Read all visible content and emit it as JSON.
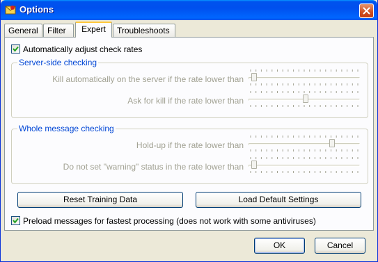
{
  "window": {
    "title": "Options"
  },
  "tabs": [
    {
      "label": "General"
    },
    {
      "label": "Filter"
    },
    {
      "label": "Expert",
      "active": true
    },
    {
      "label": "Troubleshoots"
    }
  ],
  "auto_adjust": {
    "label": "Automatically adjust check rates",
    "checked": true
  },
  "server_side": {
    "title": "Server-side checking",
    "kill_auto": {
      "label": "Kill automatically on the server if the rate lower than",
      "value": 0.03
    },
    "ask_kill": {
      "label": "Ask for kill if the rate lower than",
      "value": 0.51
    }
  },
  "whole_message": {
    "title": "Whole message checking",
    "hold_up": {
      "label": "Hold-up if the rate lower than",
      "value": 0.76
    },
    "no_warning": {
      "label": "Do not set \"warning\" status in the rate lower than",
      "value": 0.03
    }
  },
  "buttons": {
    "reset": "Reset Training Data",
    "load_default": "Load Default Settings",
    "ok": "OK",
    "cancel": "Cancel"
  },
  "preload": {
    "label": "Preload messages for fastest processing (does not work with some antiviruses)",
    "checked": true
  },
  "colors": {
    "titlebar": "#0054e3",
    "group_title": "#0046d5",
    "disabled_text": "#a1a192",
    "tab_highlight": "#ffc83c"
  },
  "icons": {
    "app": "app-icon",
    "close": "close-icon",
    "check": "checkmark-icon"
  }
}
